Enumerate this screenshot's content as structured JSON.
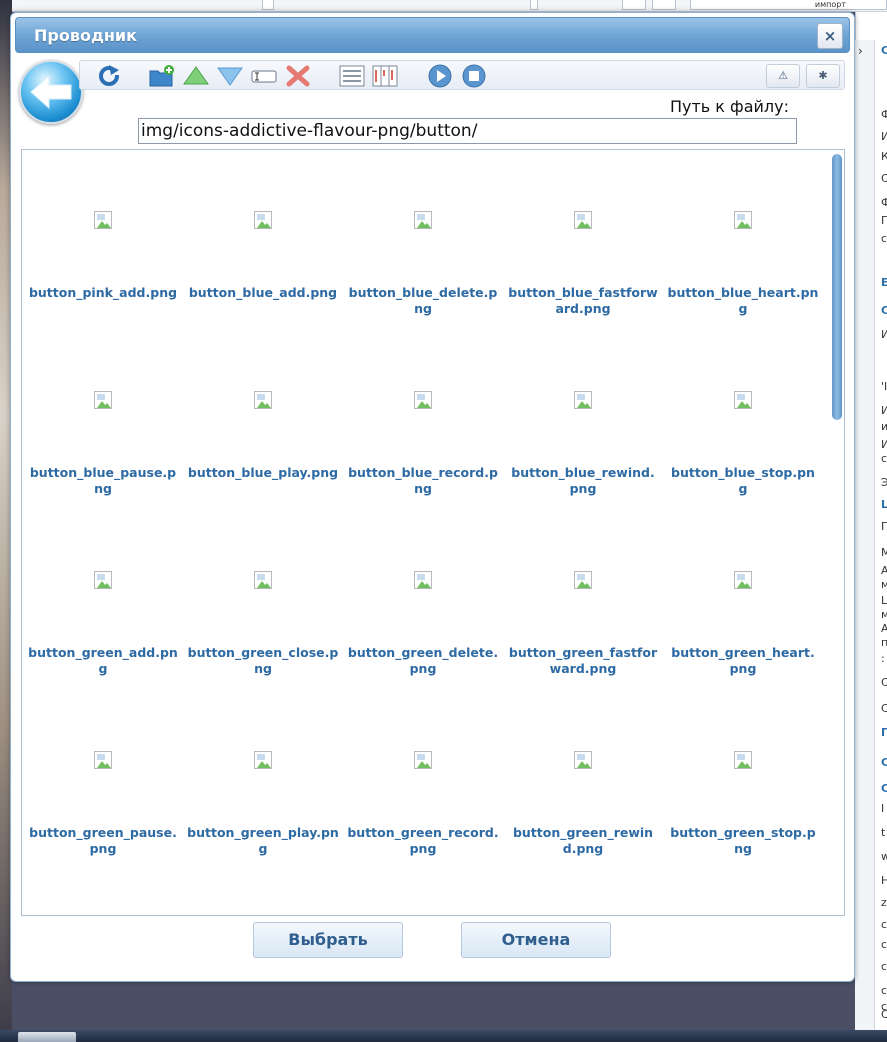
{
  "dialog": {
    "title": "Проводник",
    "close_label": "×"
  },
  "toolbar": {
    "icons": [
      "back-icon",
      "refresh-icon",
      "new-folder-icon",
      "upload-icon",
      "download-icon",
      "rename-icon",
      "delete-icon",
      "list-view-icon",
      "columns-view-icon",
      "play-icon",
      "stop-icon",
      "warning-icon",
      "settings-icon"
    ],
    "warning_label": "⚠",
    "settings_label": "✱"
  },
  "path": {
    "label": "Путь к файлу:",
    "value": "img/icons-addictive-flavour-png/button/"
  },
  "files": [
    "button_pink_add.png",
    "button_blue_add.png",
    "button_blue_delete.png",
    "button_blue_fastforward.png",
    "button_blue_heart.png",
    "button_blue_pause.png",
    "button_blue_play.png",
    "button_blue_record.png",
    "button_blue_rewind.png",
    "button_blue_stop.png",
    "button_green_add.png",
    "button_green_close.png",
    "button_green_delete.png",
    "button_green_fastforward.png",
    "button_green_heart.png",
    "button_green_pause.png",
    "button_green_play.png",
    "button_green_record.png",
    "button_green_rewind.png",
    "button_green_stop.png"
  ],
  "buttons": {
    "select": "Выбрать",
    "cancel": "Отмена"
  },
  "background": {
    "tab_text": "импорт",
    "right_letters": [
      "C",
      "Ф",
      "И",
      "К",
      "С",
      "Ф",
      "П",
      "с",
      "E",
      "C",
      "И",
      "'I",
      "И",
      "и",
      "И",
      "с",
      "Э",
      "L",
      "П",
      "М",
      "А",
      "м",
      "L",
      "м",
      "А",
      "п",
      ":",
      "C",
      "C",
      "П",
      "C",
      "C",
      "I",
      "t",
      "w",
      "H",
      "z",
      "c",
      "c",
      "c",
      "c",
      "C",
      "c"
    ]
  },
  "colors": {
    "titlebar": "#6fa5d6",
    "link": "#2e6aa3",
    "scroll_thumb": "#6ea2d2"
  }
}
